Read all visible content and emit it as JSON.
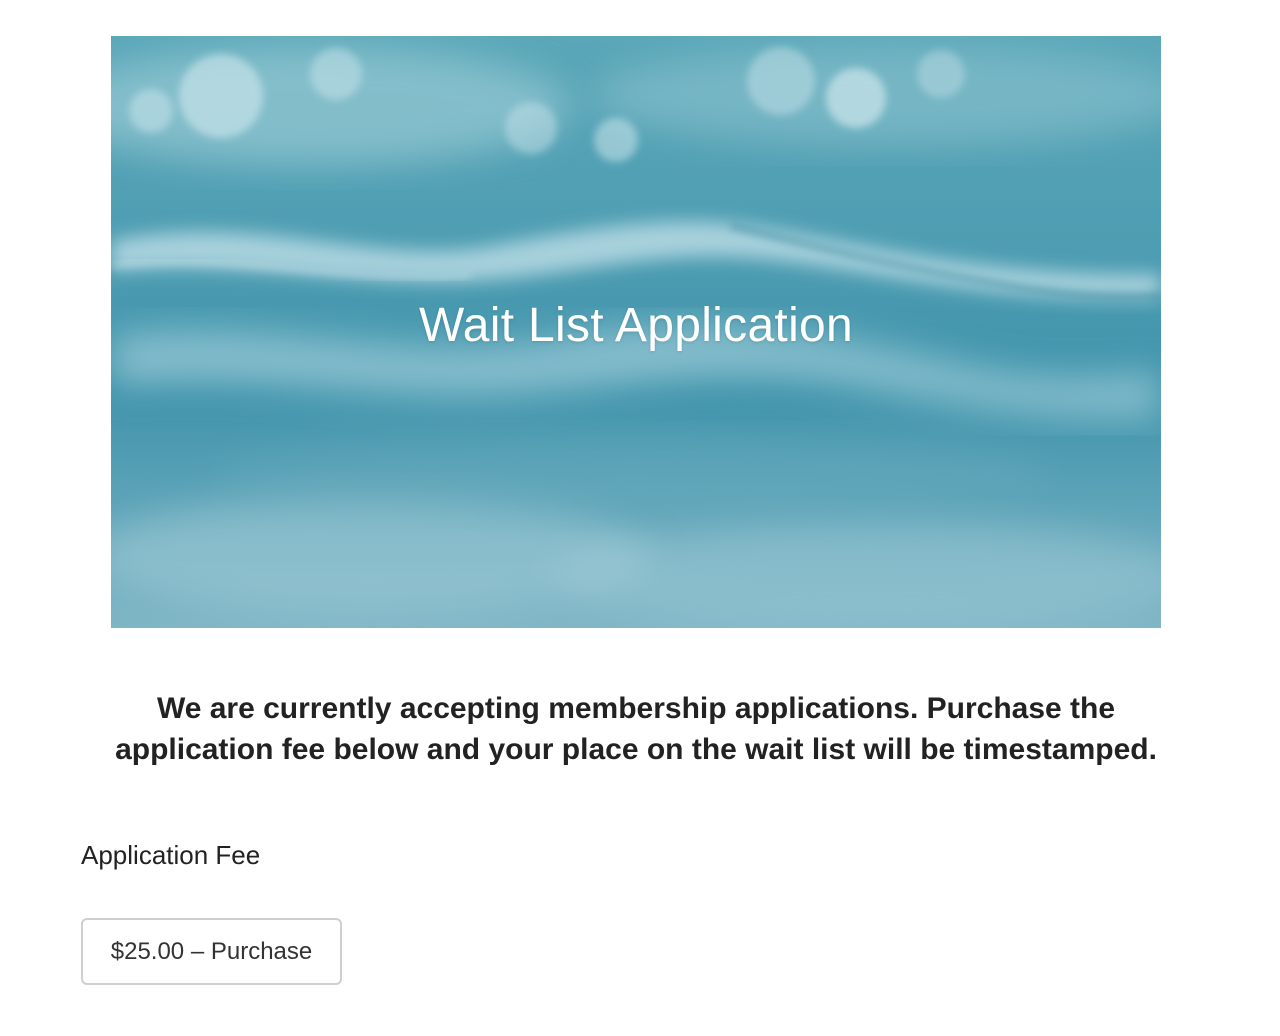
{
  "hero": {
    "title": "Wait List Application"
  },
  "intro": {
    "text": "We are currently accepting membership applications. Purchase the application fee below and your place on the wait list will be timestamped."
  },
  "product": {
    "title": "Application Fee",
    "button_label": "$25.00 – Purchase"
  },
  "colors": {
    "hero_water": "#4e9db2",
    "text": "#222222",
    "button_border": "#cfcfcf"
  }
}
